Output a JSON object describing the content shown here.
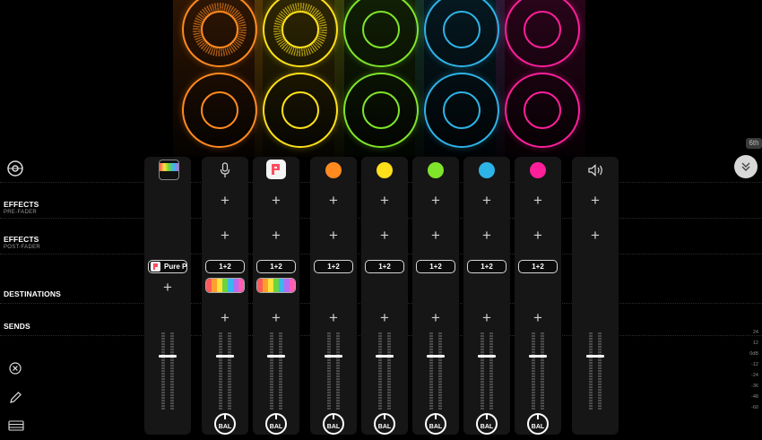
{
  "app": {
    "corner_badge": "6th"
  },
  "pads": {
    "colors": [
      "#ff8a1f",
      "#ffe01a",
      "#7fe42a",
      "#2eb3e6",
      "#ff1f9b"
    ],
    "rows": 2
  },
  "rows": {
    "effects_pre": {
      "label": "EFFECTS",
      "sub": "PRE-FADER"
    },
    "effects_post": {
      "label": "EFFECTS",
      "sub": "POST-FADER"
    },
    "destinations": {
      "label": "DESTINATIONS"
    },
    "sends": {
      "label": "SENDS"
    }
  },
  "channels": [
    {
      "type": "app-icon",
      "dest_label": "Pure Pi",
      "accent": "#ff4d5e"
    },
    {
      "type": "mic",
      "dest_label": "1+2",
      "accent": "#ffffff"
    },
    {
      "type": "app-icon-2",
      "dest_label": "1+2",
      "accent": "#ff4d5e"
    },
    {
      "type": "dot",
      "dest_label": "1+2",
      "accent": "#ff8a1f"
    },
    {
      "type": "dot",
      "dest_label": "1+2",
      "accent": "#ffe01a"
    },
    {
      "type": "dot",
      "dest_label": "1+2",
      "accent": "#7fe42a"
    },
    {
      "type": "dot",
      "dest_label": "1+2",
      "accent": "#2eb3e6"
    },
    {
      "type": "dot",
      "dest_label": "1+2",
      "accent": "#ff1f9b"
    }
  ],
  "balance_label": "BAL",
  "meter_scale": [
    "24",
    "12",
    "0dB",
    "-12",
    "-24",
    "-36",
    "-48",
    "-60"
  ],
  "collapse_icon": "chevron-double-down-icon"
}
